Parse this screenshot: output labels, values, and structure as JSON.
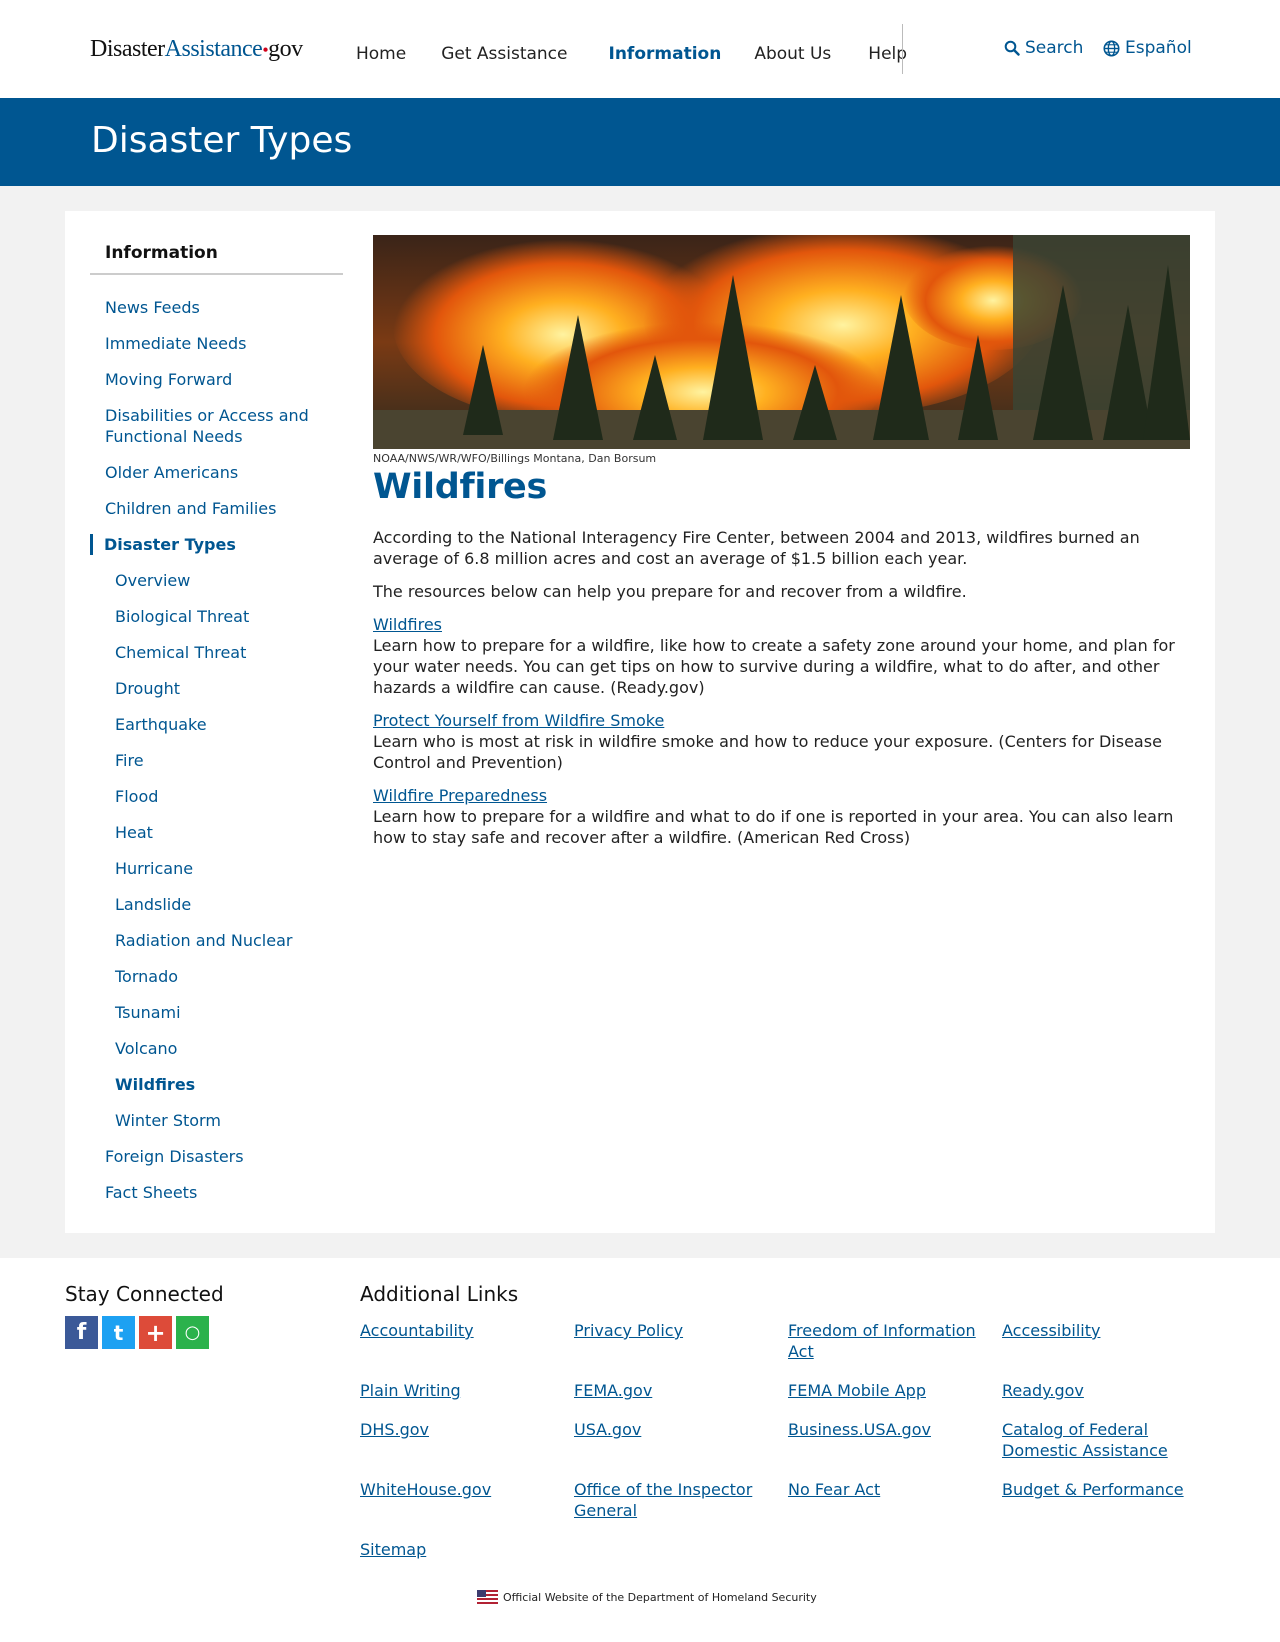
{
  "header": {
    "logo": {
      "part1": "Disaster",
      "part2": "Assistance",
      "dot": "•",
      "part3": "gov"
    },
    "nav": [
      {
        "label": "Home",
        "active": false
      },
      {
        "label": "Get Assistance",
        "active": false
      },
      {
        "label": "Information",
        "active": true
      },
      {
        "label": "About Us",
        "active": false
      },
      {
        "label": "Help",
        "active": false
      }
    ],
    "search_label": "Search",
    "language_label": "Español",
    "search_icon": "search-icon",
    "language_icon": "globe-icon"
  },
  "banner": {
    "title": "Disaster Types"
  },
  "sidebar": {
    "title": "Information",
    "items": [
      {
        "label": "News Feeds"
      },
      {
        "label": "Immediate Needs"
      },
      {
        "label": "Moving Forward"
      },
      {
        "label": "Disabilities or Access and Functional Needs"
      },
      {
        "label": "Older Americans"
      },
      {
        "label": "Children and Families"
      },
      {
        "label": "Disaster Types"
      },
      {
        "label": "Overview"
      },
      {
        "label": "Biological Threat"
      },
      {
        "label": "Chemical Threat"
      },
      {
        "label": "Drought"
      },
      {
        "label": "Earthquake"
      },
      {
        "label": "Fire"
      },
      {
        "label": "Flood"
      },
      {
        "label": "Heat"
      },
      {
        "label": "Hurricane"
      },
      {
        "label": "Landslide"
      },
      {
        "label": "Radiation and Nuclear"
      },
      {
        "label": "Tornado"
      },
      {
        "label": "Tsunami"
      },
      {
        "label": "Volcano"
      },
      {
        "label": "Wildfires"
      },
      {
        "label": "Winter Storm"
      },
      {
        "label": "Foreign Disasters"
      },
      {
        "label": "Fact Sheets"
      }
    ]
  },
  "content": {
    "image_credit": "NOAA/NWS/WR/WFO/Billings Montana, Dan Borsum",
    "title": "Wildfires",
    "intro": "According to the National Interagency Fire Center, between 2004 and 2013, wildfires burned an average of 6.8 million acres and cost an average of $1.5 billion each year.",
    "intro2": "The resources below can help you prepare for and recover from a wildfire.",
    "resources": [
      {
        "link": "Wildfires",
        "text": "Learn how to prepare for a wildfire, like how to create a safety zone around your home, and plan for your water needs. You can get tips on how to survive during a wildfire, what to do after, and other hazards a wildfire can cause. (Ready.gov)"
      },
      {
        "link": "Protect Yourself from Wildfire Smoke",
        "text": "Learn who is most at risk in wildfire smoke and how to reduce your exposure. (Centers for Disease Control and Prevention)"
      },
      {
        "link": "Wildfire Preparedness",
        "text": "Learn how to prepare for a wildfire and what to do if one is reported in your area. You can also learn how to stay safe and recover after a wildfire. (American Red Cross)"
      }
    ]
  },
  "footer": {
    "stay_connected": "Stay Connected",
    "social": [
      {
        "icon": "facebook-icon",
        "glyph": "f",
        "color": "#3b5998"
      },
      {
        "icon": "twitter-icon",
        "glyph": "t",
        "color": "#1da1f2"
      },
      {
        "icon": "google-plus-icon",
        "glyph": "+",
        "color": "#dd4b39"
      },
      {
        "icon": "chat-icon",
        "glyph": "○",
        "color": "#2bb24c"
      }
    ],
    "additional_links_title": "Additional Links",
    "links": [
      [
        "Accountability",
        "Privacy Policy",
        "Freedom of Information Act",
        "Accessibility"
      ],
      [
        "Plain Writing",
        "FEMA.gov",
        "FEMA Mobile App",
        "Ready.gov"
      ],
      [
        "DHS.gov",
        "USA.gov",
        "Business.USA.gov",
        "Catalog of Federal Domestic Assistance"
      ],
      [
        "WhiteHouse.gov",
        "Office of the Inspector General",
        "No Fear Act",
        "Budget & Performance"
      ],
      [
        "Sitemap"
      ]
    ],
    "official": "Official Website of the Department of Homeland Security"
  },
  "colors": {
    "brand_blue": "#005691",
    "logo_dot_red": "#d0021b"
  }
}
